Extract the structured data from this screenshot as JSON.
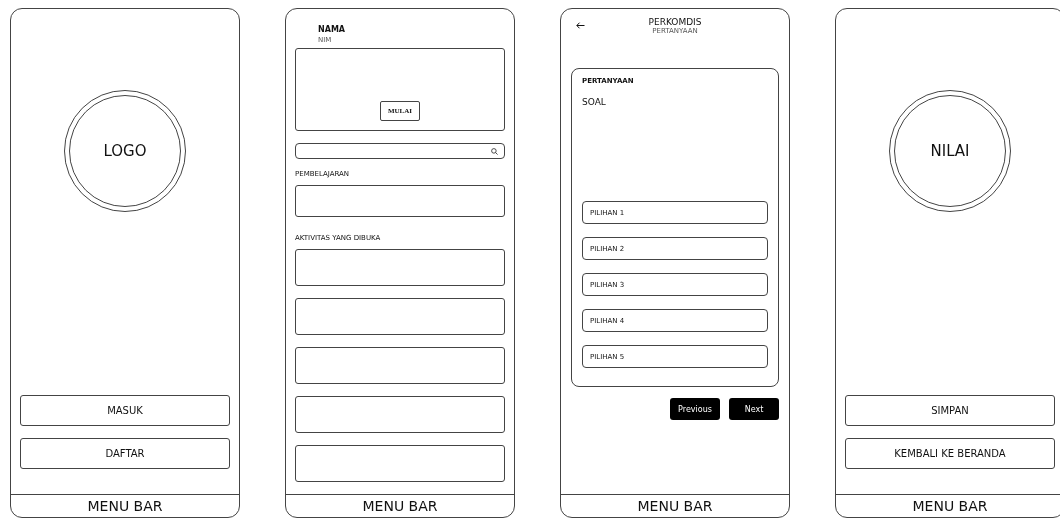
{
  "screens": [
    {
      "kind": "splash",
      "logo": "LOGO",
      "buttons": [
        "MASUK",
        "DAFTAR"
      ],
      "menu_bar": "MENU BAR"
    },
    {
      "kind": "home",
      "name": "NAMA",
      "nim": "NIM",
      "start_button": "MULAI",
      "section_1": "PEMBELAJARAN",
      "section_2": "AKTIVITAS YANG DIBUKA",
      "menu_bar": "MENU BAR"
    },
    {
      "kind": "quiz",
      "title": "PERKOMDIS",
      "subtitle": "PERTANYAAN",
      "question_label": "PERTANYAAN",
      "question": "SOAL",
      "options": [
        "PILIHAN 1",
        "PILIHAN 2",
        "PILIHAN 3",
        "PILIHAN 4",
        "PILIHAN 5"
      ],
      "nav_buttons": [
        "Previous",
        "Next"
      ],
      "menu_bar": "MENU BAR"
    },
    {
      "kind": "splash",
      "logo": "NILAI",
      "buttons": [
        "SIMPAN",
        "KEMBALI KE BERANDA"
      ],
      "menu_bar": "MENU BAR"
    }
  ]
}
